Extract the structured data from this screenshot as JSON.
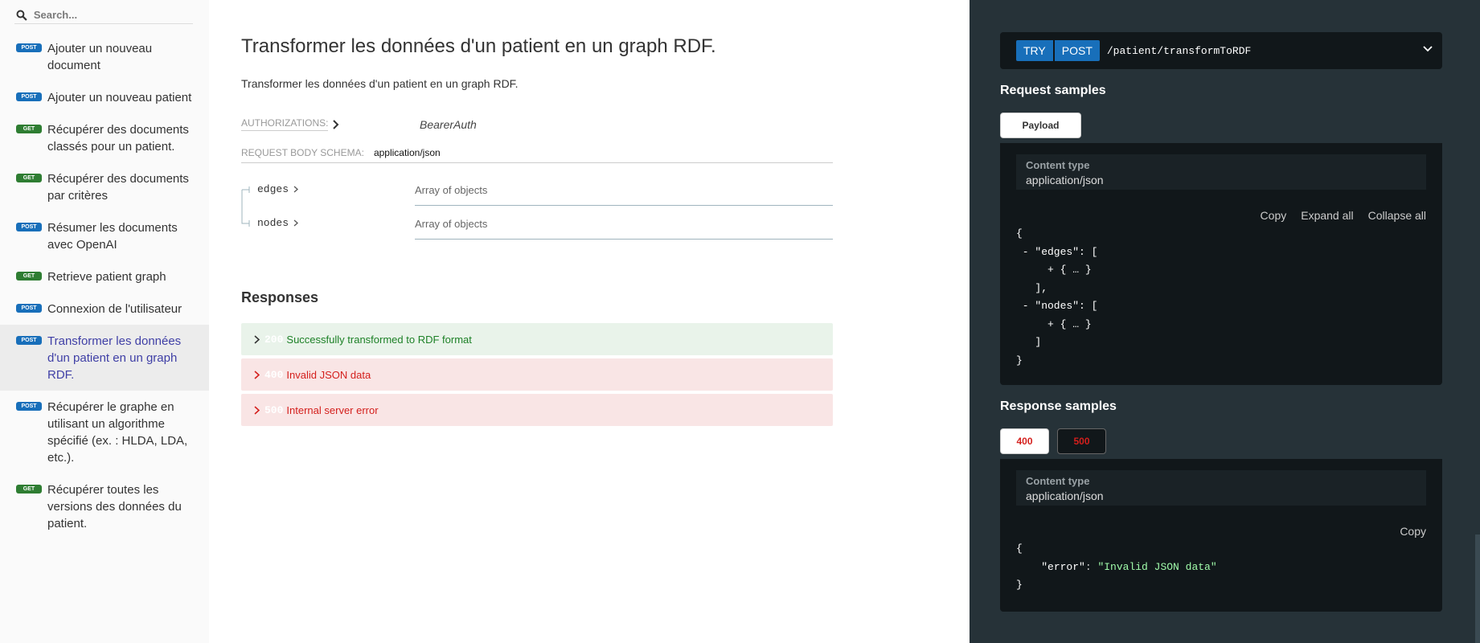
{
  "sidebar": {
    "search_placeholder": "Search...",
    "items": [
      {
        "method": "POST",
        "label": "Ajouter un nouveau document"
      },
      {
        "method": "POST",
        "label": "Ajouter un nouveau patient"
      },
      {
        "method": "GET",
        "label": "Récupérer des documents classés pour un patient."
      },
      {
        "method": "GET",
        "label": "Récupérer des documents par critères"
      },
      {
        "method": "POST",
        "label": "Résumer les documents avec OpenAI"
      },
      {
        "method": "GET",
        "label": "Retrieve patient graph"
      },
      {
        "method": "POST",
        "label": "Connexion de l'utilisateur"
      },
      {
        "method": "POST",
        "label": "Transformer les données d'un patient en un graph RDF."
      },
      {
        "method": "POST",
        "label": "Récupérer le graphe en utilisant un algorithme spécifié (ex. : HLDA, LDA, etc.)."
      },
      {
        "method": "GET",
        "label": "Récupérer toutes les versions des données du patient."
      }
    ]
  },
  "main": {
    "title": "Transformer les données d'un patient en un graph RDF.",
    "description": "Transformer les données d'un patient en un graph RDF.",
    "auth_label": "AUTHORIZATIONS:",
    "auth_value": "BearerAuth",
    "schema_label": "REQUEST BODY SCHEMA:",
    "schema_value": "application/json",
    "properties": [
      {
        "name": "edges",
        "type": "Array of objects"
      },
      {
        "name": "nodes",
        "type": "Array of objects"
      }
    ],
    "responses_title": "Responses",
    "responses": [
      {
        "code": "200",
        "text": "Successfully transformed to RDF format"
      },
      {
        "code": "400",
        "text": "Invalid JSON data"
      },
      {
        "code": "500",
        "text": "Internal server error"
      }
    ]
  },
  "right": {
    "try_label": "TRY",
    "method": "POST",
    "path": "/patient/transformToRDF",
    "request_samples_title": "Request samples",
    "payload_tab": "Payload",
    "content_type_label": "Content type",
    "content_type_value": "application/json",
    "copy": "Copy",
    "expand_all": "Expand all",
    "collapse_all": "Collapse all",
    "request_json": {
      "open": "{",
      "edges_line": " - \"edges\": [",
      "edges_item": "     + { … }",
      "edges_close": "   ],",
      "nodes_line": " - \"nodes\": [",
      "nodes_item": "     + { … }",
      "nodes_close": "   ]",
      "close": "}"
    },
    "response_samples_title": "Response samples",
    "tab_400": "400",
    "tab_500": "500",
    "response_content_type_label": "Content type",
    "response_content_type_value": "application/json",
    "response_copy": "Copy",
    "response_json": {
      "open": "{",
      "key": "\"error\"",
      "colon": ": ",
      "value": "\"Invalid JSON data\"",
      "close": "}"
    }
  },
  "colors": {
    "post_badge": "#186fba",
    "get_badge": "#2e7d32",
    "success": "#1d8127",
    "error": "#d41f1c",
    "right_panel_bg": "#263238"
  }
}
